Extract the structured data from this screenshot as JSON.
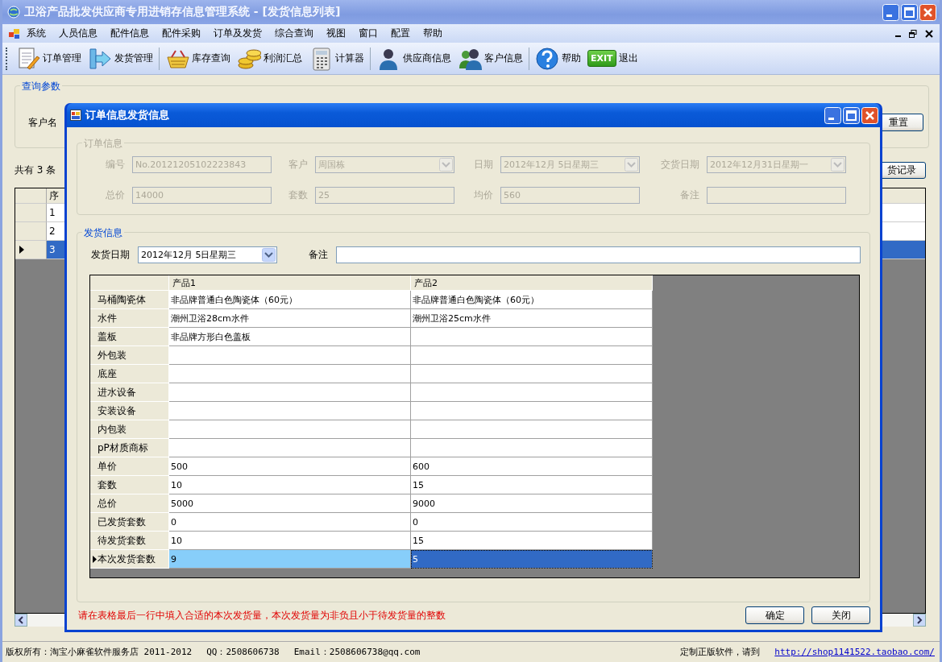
{
  "window": {
    "title": "卫浴产品批发供应商专用进销存信息管理系统 - [发货信息列表]"
  },
  "menu": [
    "系统",
    "人员信息",
    "配件信息",
    "配件采购",
    "订单及发货",
    "综合查询",
    "视图",
    "窗口",
    "配置",
    "帮助"
  ],
  "toolbar": [
    {
      "items": [
        {
          "label": "订单管理"
        },
        {
          "label": "发货管理"
        }
      ]
    },
    {
      "items": [
        {
          "label": "库存查询"
        },
        {
          "label": "利润汇总"
        },
        {
          "label": "计算器"
        }
      ]
    },
    {
      "items": [
        {
          "label": "供应商信息"
        },
        {
          "label": "客户信息"
        }
      ]
    },
    {
      "items": [
        {
          "label": "帮助"
        },
        {
          "label": "退出",
          "badge": "EXIT"
        }
      ]
    }
  ],
  "query_group": {
    "title": "查询参数",
    "label": "客户名",
    "reset_button": "重置"
  },
  "record_count": "共有 3 条",
  "records_button": "货记录",
  "list": {
    "columns": [
      "序"
    ],
    "rows": [
      {
        "cells": [
          "1"
        ],
        "selected": false
      },
      {
        "cells": [
          "2"
        ],
        "selected": false
      },
      {
        "cells": [
          "3"
        ],
        "selected": true
      }
    ]
  },
  "dialog": {
    "title": "订单信息发货信息",
    "order_info": {
      "title": "订单信息",
      "disabled": true,
      "fields": [
        {
          "label": "编号",
          "value": "No.20121205102223843",
          "kind": "text"
        },
        {
          "label": "客户",
          "value": "周国栋",
          "kind": "dropdown"
        },
        {
          "label": "日期",
          "value": "2012年12月 5日星期三",
          "kind": "dropdown"
        },
        {
          "label": "交货日期",
          "value": "2012年12月31日星期一",
          "kind": "dropdown"
        },
        {
          "label": "总价",
          "value": "14000",
          "kind": "text"
        },
        {
          "label": "套数",
          "value": "25",
          "kind": "text"
        },
        {
          "label": "均价",
          "value": "560",
          "kind": "text"
        },
        {
          "label": "备注",
          "kind": "text"
        }
      ]
    },
    "shipping": {
      "title": "发货信息",
      "date_label": "发货日期",
      "date": "2012年12月 5日星期三",
      "note_label": "备注",
      "columns": [
        "产品1",
        "产品2"
      ],
      "rows": [
        {
          "label": "马桶陶瓷体",
          "current": false,
          "cells": [
            {
              "text": "非品牌普通白色陶瓷体（60元）",
              "selected": false
            },
            {
              "text": "非品牌普通白色陶瓷体（60元）",
              "selected": false
            }
          ]
        },
        {
          "label": "水件",
          "current": false,
          "cells": [
            {
              "text": "潮州卫浴28cm水件",
              "selected": false
            },
            {
              "text": "潮州卫浴25cm水件",
              "selected": false
            }
          ]
        },
        {
          "label": "盖板",
          "current": false,
          "cells": [
            {
              "text": "非品牌方形白色盖板",
              "selected": false
            },
            {
              "selected": false
            }
          ]
        },
        {
          "label": "外包装",
          "current": false,
          "cells": [
            {
              "selected": false
            },
            {
              "selected": false
            }
          ]
        },
        {
          "label": "底座",
          "current": false,
          "cells": [
            {
              "selected": false
            },
            {
              "selected": false
            }
          ]
        },
        {
          "label": "进水设备",
          "current": false,
          "cells": [
            {
              "selected": false
            },
            {
              "selected": false
            }
          ]
        },
        {
          "label": "安装设备",
          "current": false,
          "cells": [
            {
              "selected": false
            },
            {
              "selected": false
            }
          ]
        },
        {
          "label": "内包装",
          "current": false,
          "cells": [
            {
              "selected": false
            },
            {
              "selected": false
            }
          ]
        },
        {
          "label": "pP材质商标",
          "current": false,
          "cells": [
            {
              "selected": false
            },
            {
              "selected": false
            }
          ]
        },
        {
          "label": "单价",
          "current": false,
          "cells": [
            {
              "text": "500",
              "selected": false
            },
            {
              "text": "600",
              "selected": false
            }
          ]
        },
        {
          "label": "套数",
          "current": false,
          "cells": [
            {
              "text": "10",
              "selected": false
            },
            {
              "text": "15",
              "selected": false
            }
          ]
        },
        {
          "label": "总价",
          "current": false,
          "cells": [
            {
              "text": "5000",
              "selected": false
            },
            {
              "text": "9000",
              "selected": false
            }
          ]
        },
        {
          "label": "已发货套数",
          "current": false,
          "cells": [
            {
              "text": "0",
              "selected": false
            },
            {
              "text": "0",
              "selected": false
            }
          ]
        },
        {
          "label": "待发货套数",
          "current": false,
          "cells": [
            {
              "text": "10",
              "selected": false
            },
            {
              "text": "15",
              "selected": false
            }
          ]
        },
        {
          "label": "本次发货套数",
          "current": true,
          "cells": [
            {
              "text": "9",
              "selected": false
            },
            {
              "text": "5",
              "selected": true
            }
          ]
        }
      ]
    },
    "hint": "请在表格最后一行中填入合适的本次发货量，本次发货量为非负且小于待发货量的整数",
    "buttons": [
      "确定",
      "关闭"
    ]
  },
  "status_bar": {
    "copyright": "版权所有：淘宝小麻雀软件服务店 2011-2012",
    "qq": "QQ：2508606738",
    "email": "Email：2508606738@qq.com",
    "promo": "定制正版软件，请到",
    "link": "http://shop1141522.taobao.com/"
  }
}
